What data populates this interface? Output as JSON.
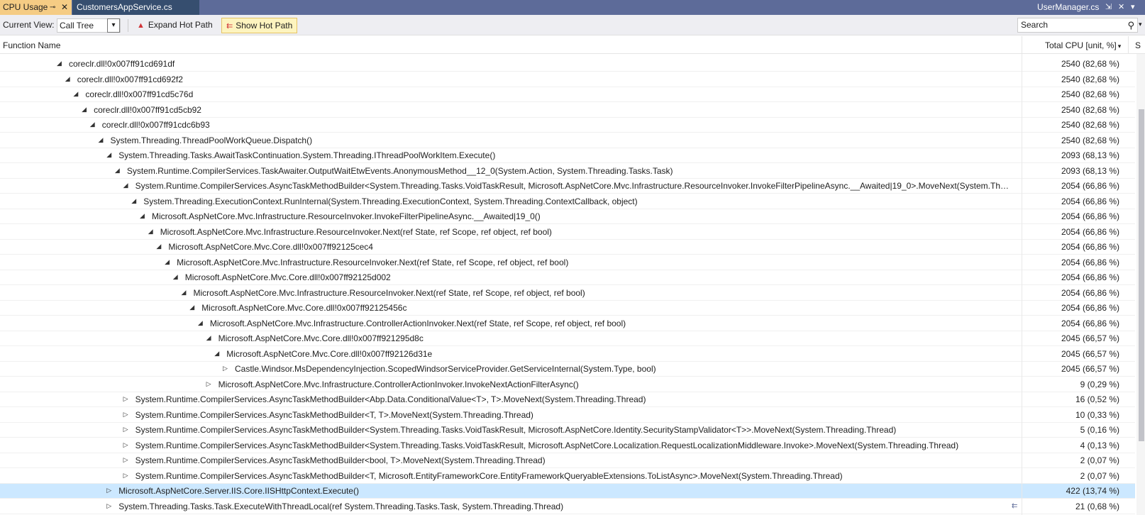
{
  "tabs": {
    "active": {
      "label": "CPU Usage",
      "pin_glyph": "⊸",
      "close_glyph": "✕"
    },
    "second": {
      "label": "CustomersAppService.cs"
    },
    "right": {
      "label": "UserManager.cs",
      "pin_glyph": "⇲",
      "close_glyph": "✕"
    }
  },
  "toolbar": {
    "current_view_label": "Current View:",
    "current_view_value": "Call Tree",
    "expand_hot_path": "Expand Hot Path",
    "show_hot_path": "Show Hot Path",
    "search_placeholder": "Search"
  },
  "columns": {
    "function_name": "Function Name",
    "total_cpu": "Total CPU [unit, %]"
  },
  "rows": [
    {
      "name": "coreclr.dll!0x007ff91cd691df",
      "value": "2540 (82,68 %)",
      "depth": 0,
      "expanded": true
    },
    {
      "name": "coreclr.dll!0x007ff91cd692f2",
      "value": "2540 (82,68 %)",
      "depth": 1,
      "expanded": true
    },
    {
      "name": "coreclr.dll!0x007ff91cd5c76d",
      "value": "2540 (82,68 %)",
      "depth": 2,
      "expanded": true
    },
    {
      "name": "coreclr.dll!0x007ff91cd5cb92",
      "value": "2540 (82,68 %)",
      "depth": 3,
      "expanded": true
    },
    {
      "name": "coreclr.dll!0x007ff91cdc6b93",
      "value": "2540 (82,68 %)",
      "depth": 4,
      "expanded": true
    },
    {
      "name": "System.Threading.ThreadPoolWorkQueue.Dispatch()",
      "value": "2540 (82,68 %)",
      "depth": 5,
      "expanded": true
    },
    {
      "name": "System.Threading.Tasks.AwaitTaskContinuation.System.Threading.IThreadPoolWorkItem.Execute()",
      "value": "2093 (68,13 %)",
      "depth": 6,
      "expanded": true
    },
    {
      "name": "System.Runtime.CompilerServices.TaskAwaiter.OutputWaitEtwEvents.AnonymousMethod__12_0(System.Action, System.Threading.Tasks.Task)",
      "value": "2093 (68,13 %)",
      "depth": 7,
      "expanded": true
    },
    {
      "name": "System.Runtime.CompilerServices.AsyncTaskMethodBuilder<System.Threading.Tasks.VoidTaskResult, Microsoft.AspNetCore.Mvc.Infrastructure.ResourceInvoker.InvokeFilterPipelineAsync.__Awaited|19_0>.MoveNext(System.Threading...",
      "value": "2054 (66,86 %)",
      "depth": 8,
      "expanded": true
    },
    {
      "name": "System.Threading.ExecutionContext.RunInternal(System.Threading.ExecutionContext, System.Threading.ContextCallback, object)",
      "value": "2054 (66,86 %)",
      "depth": 9,
      "expanded": true
    },
    {
      "name": "Microsoft.AspNetCore.Mvc.Infrastructure.ResourceInvoker.InvokeFilterPipelineAsync.__Awaited|19_0()",
      "value": "2054 (66,86 %)",
      "depth": 10,
      "expanded": true
    },
    {
      "name": "Microsoft.AspNetCore.Mvc.Infrastructure.ResourceInvoker.Next(ref State, ref Scope, ref object, ref bool)",
      "value": "2054 (66,86 %)",
      "depth": 11,
      "expanded": true
    },
    {
      "name": "Microsoft.AspNetCore.Mvc.Core.dll!0x007ff92125cec4",
      "value": "2054 (66,86 %)",
      "depth": 12,
      "expanded": true
    },
    {
      "name": "Microsoft.AspNetCore.Mvc.Infrastructure.ResourceInvoker.Next(ref State, ref Scope, ref object, ref bool)",
      "value": "2054 (66,86 %)",
      "depth": 13,
      "expanded": true
    },
    {
      "name": "Microsoft.AspNetCore.Mvc.Core.dll!0x007ff92125d002",
      "value": "2054 (66,86 %)",
      "depth": 14,
      "expanded": true
    },
    {
      "name": "Microsoft.AspNetCore.Mvc.Infrastructure.ResourceInvoker.Next(ref State, ref Scope, ref object, ref bool)",
      "value": "2054 (66,86 %)",
      "depth": 15,
      "expanded": true
    },
    {
      "name": "Microsoft.AspNetCore.Mvc.Core.dll!0x007ff92125456c",
      "value": "2054 (66,86 %)",
      "depth": 16,
      "expanded": true
    },
    {
      "name": "Microsoft.AspNetCore.Mvc.Infrastructure.ControllerActionInvoker.Next(ref State, ref Scope, ref object, ref bool)",
      "value": "2054 (66,86 %)",
      "depth": 17,
      "expanded": true
    },
    {
      "name": "Microsoft.AspNetCore.Mvc.Core.dll!0x007ff921295d8c",
      "value": "2045 (66,57 %)",
      "depth": 18,
      "expanded": true
    },
    {
      "name": "Microsoft.AspNetCore.Mvc.Core.dll!0x007ff92126d31e",
      "value": "2045 (66,57 %)",
      "depth": 19,
      "expanded": true
    },
    {
      "name": "Castle.Windsor.MsDependencyInjection.ScopedWindsorServiceProvider.GetServiceInternal(System.Type, bool)",
      "value": "2045 (66,57 %)",
      "depth": 20,
      "expanded": false
    },
    {
      "name": "Microsoft.AspNetCore.Mvc.Infrastructure.ControllerActionInvoker.InvokeNextActionFilterAsync()",
      "value": "9 (0,29 %)",
      "depth": 18,
      "expanded": false
    },
    {
      "name": "System.Runtime.CompilerServices.AsyncTaskMethodBuilder<Abp.Data.ConditionalValue<T>, T>.MoveNext(System.Threading.Thread)",
      "value": "16 (0,52 %)",
      "depth": 8,
      "expanded": false
    },
    {
      "name": "System.Runtime.CompilerServices.AsyncTaskMethodBuilder<T, T>.MoveNext(System.Threading.Thread)",
      "value": "10 (0,33 %)",
      "depth": 8,
      "expanded": false
    },
    {
      "name": "System.Runtime.CompilerServices.AsyncTaskMethodBuilder<System.Threading.Tasks.VoidTaskResult, Microsoft.AspNetCore.Identity.SecurityStampValidator<T>>.MoveNext(System.Threading.Thread)",
      "value": "5 (0,16 %)",
      "depth": 8,
      "expanded": false
    },
    {
      "name": "System.Runtime.CompilerServices.AsyncTaskMethodBuilder<System.Threading.Tasks.VoidTaskResult, Microsoft.AspNetCore.Localization.RequestLocalizationMiddleware.Invoke>.MoveNext(System.Threading.Thread)",
      "value": "4 (0,13 %)",
      "depth": 8,
      "expanded": false
    },
    {
      "name": "System.Runtime.CompilerServices.AsyncTaskMethodBuilder<bool, T>.MoveNext(System.Threading.Thread)",
      "value": "2 (0,07 %)",
      "depth": 8,
      "expanded": false
    },
    {
      "name": "System.Runtime.CompilerServices.AsyncTaskMethodBuilder<T, Microsoft.EntityFrameworkCore.EntityFrameworkQueryableExtensions.ToListAsync>.MoveNext(System.Threading.Thread)",
      "value": "2 (0,07 %)",
      "depth": 8,
      "expanded": false
    },
    {
      "name": "Microsoft.AspNetCore.Server.IIS.Core.IISHttpContext.Execute()",
      "value": "422 (13,74 %)",
      "depth": 6,
      "expanded": false,
      "selected": true
    },
    {
      "name": "System.Threading.Tasks.Task.ExecuteWithThreadLocal(ref System.Threading.Tasks.Task, System.Threading.Thread)",
      "value": "21 (0,68 %)",
      "depth": 6,
      "expanded": false,
      "hot_icon": true
    }
  ],
  "glyphs": {
    "expanded": "◢",
    "collapsed": "▷",
    "dropdown": "▾",
    "search": "⚲",
    "flame": "🔥",
    "hot_path": "⇇"
  }
}
